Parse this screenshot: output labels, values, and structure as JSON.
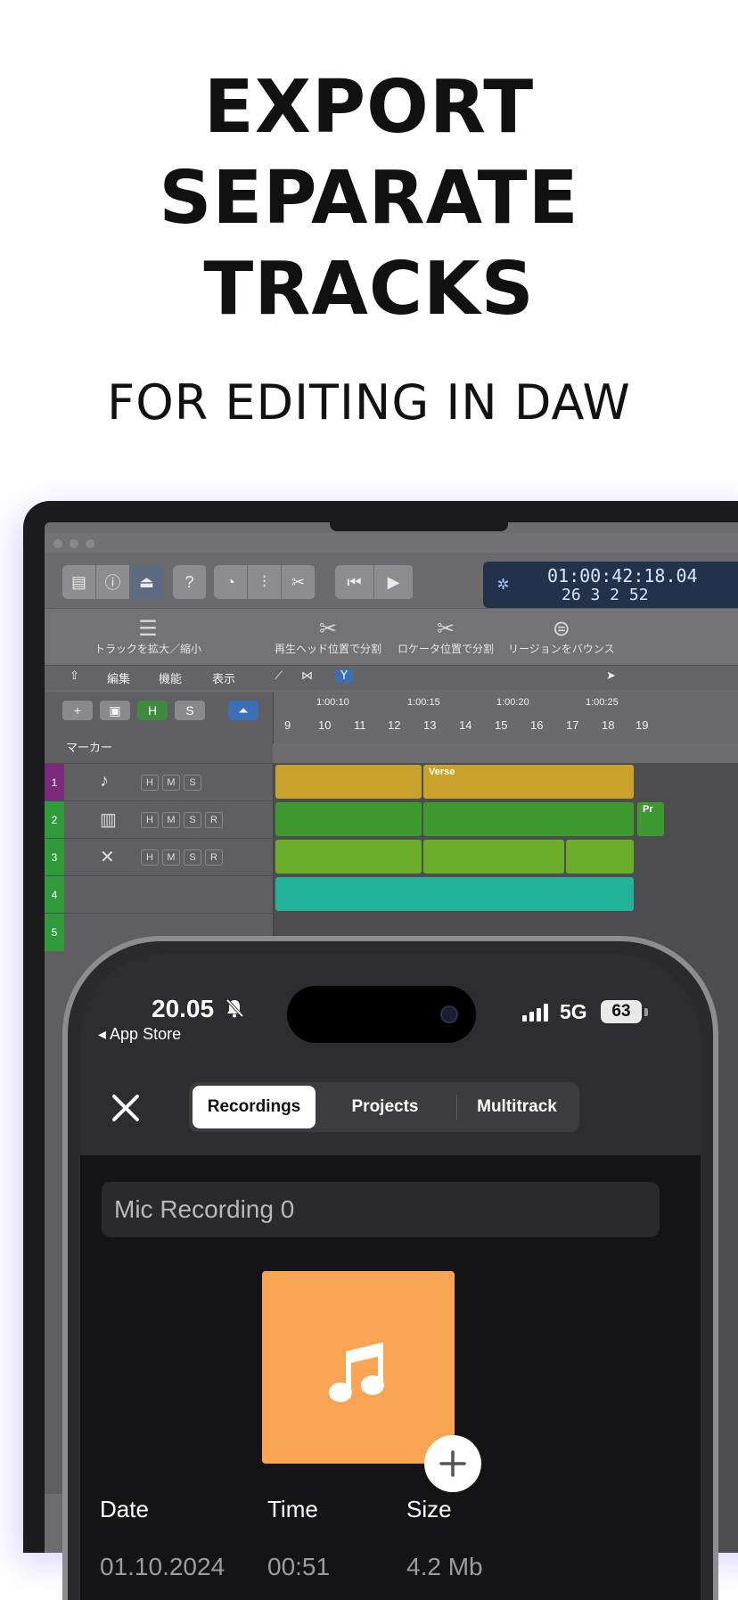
{
  "headline": {
    "lines": [
      "EXPORT",
      "SEPARATE",
      "TRACKS"
    ],
    "subtitle": "FOR EDITING IN DAW"
  },
  "daw": {
    "lcd_time": "01:00:42:18.04",
    "lcd_bars": "26  3  2   52",
    "functions": [
      "トラックを拡大／縮小",
      "再生ヘッド位置で分割",
      "ロケータ位置で分割",
      "リージョンをバウンス"
    ],
    "menus": [
      "編集",
      "機能",
      "表示"
    ],
    "track_buttons": [
      "+",
      "H",
      "S"
    ],
    "marker_label": "マーカー",
    "ruler_bars": [
      "9",
      "10",
      "11",
      "12",
      "13",
      "14",
      "15",
      "16",
      "17",
      "18",
      "19"
    ],
    "ruler_times": [
      "1:00:10",
      "1:00:15",
      "1:00:20",
      "1:00:25"
    ],
    "tracks": [
      {
        "num": "1",
        "color": "#7a2a7a",
        "buttons": [
          "H",
          "M",
          "S"
        ]
      },
      {
        "num": "2",
        "color": "#2f9a3a",
        "buttons": [
          "H",
          "M",
          "S",
          "R"
        ]
      },
      {
        "num": "3",
        "color": "#2f9a3a",
        "buttons": [
          "H",
          "M",
          "S",
          "R"
        ]
      },
      {
        "num": "4",
        "color": "#2f9a3a",
        "buttons": []
      },
      {
        "num": "5",
        "color": "#2f9a3a",
        "buttons": []
      }
    ],
    "region_labels": {
      "verse": "Verse",
      "pr": "Pr"
    }
  },
  "phone": {
    "status": {
      "time": "20.05",
      "back_label": "◂ App Store",
      "network": "5G",
      "battery": "63"
    },
    "tabs": [
      {
        "label": "Recordings",
        "active": true
      },
      {
        "label": "Projects",
        "active": false
      },
      {
        "label": "Multitrack",
        "active": false
      }
    ],
    "recording_name": "Mic Recording 0",
    "meta": {
      "date_label": "Date",
      "time_label": "Time",
      "size_label": "Size",
      "date_value": "01.10.2024",
      "time_value": "00:51",
      "size_value": "4.2 Mb"
    },
    "colors": {
      "artwork": "#f9a453",
      "background": "#141416"
    }
  }
}
